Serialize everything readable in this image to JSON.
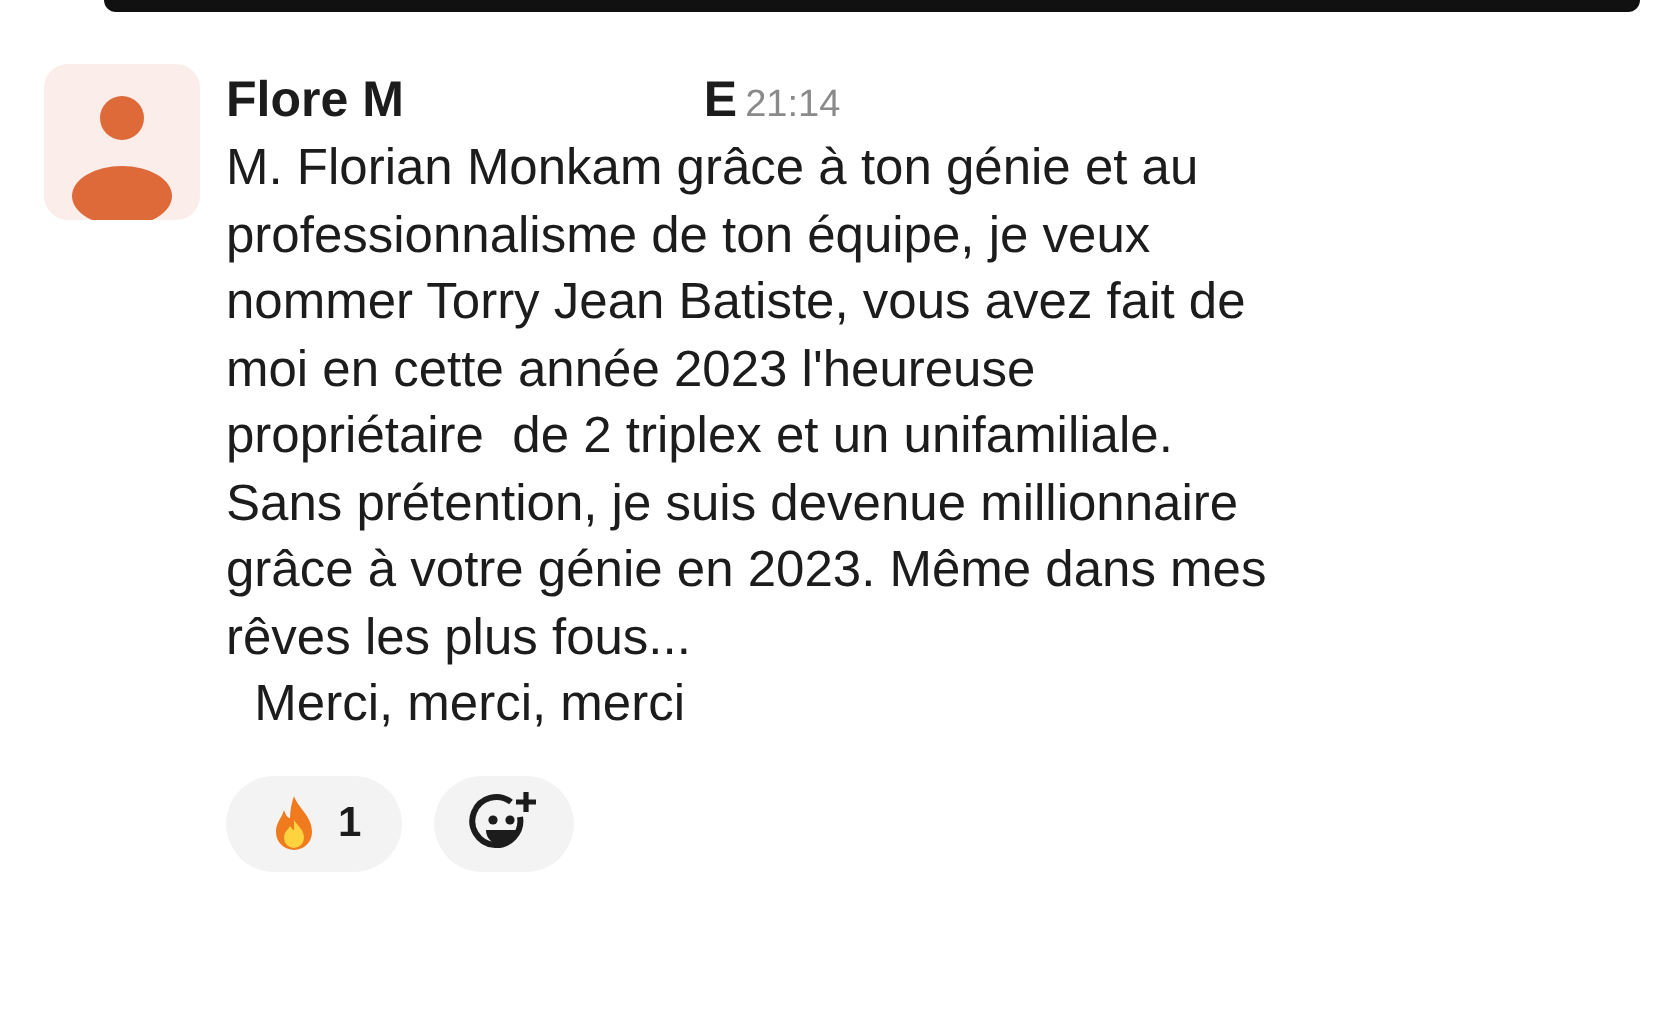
{
  "message": {
    "sender_name_parts": [
      "Flore M",
      "E"
    ],
    "time": "21:14",
    "text": "M. Florian Monkam grâce à ton génie et au\nprofessionnalisme de ton équipe, je veux\nnommer Torry Jean Batiste, vous avez fait de\nmoi en cette année 2023 l'heureuse\npropriétaire  de 2 triplex et un unifamiliale.\nSans prétention, je suis devenue millionnaire\ngrâce à votre génie en 2023. Même dans mes\nrêves les plus fous...\n  Merci, merci, merci",
    "reactions": [
      {
        "kind": "fire",
        "count": "1"
      }
    ]
  }
}
